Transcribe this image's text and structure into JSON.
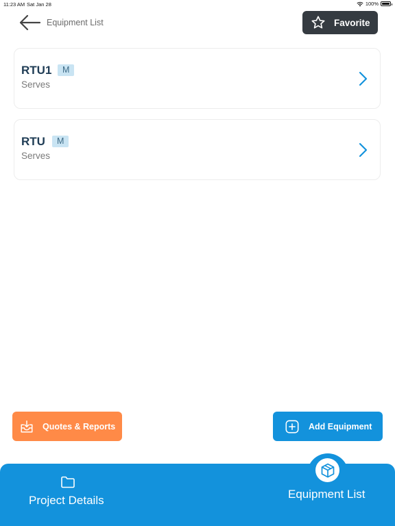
{
  "status_bar": {
    "time": "11:23 AM",
    "date": "Sat Jan 28",
    "battery": "100%",
    "battery_level": 1.0
  },
  "header": {
    "title": "Equipment List",
    "favorite_label": "Favorite",
    "back_icon": "arrow-left-icon",
    "favorite_icon": "star-icon"
  },
  "equipment": [
    {
      "name": "RTU1",
      "badge": "M",
      "subtitle": "Serves"
    },
    {
      "name": "RTU",
      "badge": "M",
      "subtitle": "Serves"
    }
  ],
  "actions": {
    "quotes_label": "Quotes & Reports",
    "add_label": "Add Equipment",
    "quotes_color": "#ff8a47",
    "add_color": "#1392dc"
  },
  "nav": {
    "project_label": "Project Details",
    "equipment_label": "Equipment List",
    "color": "#1392dc"
  }
}
